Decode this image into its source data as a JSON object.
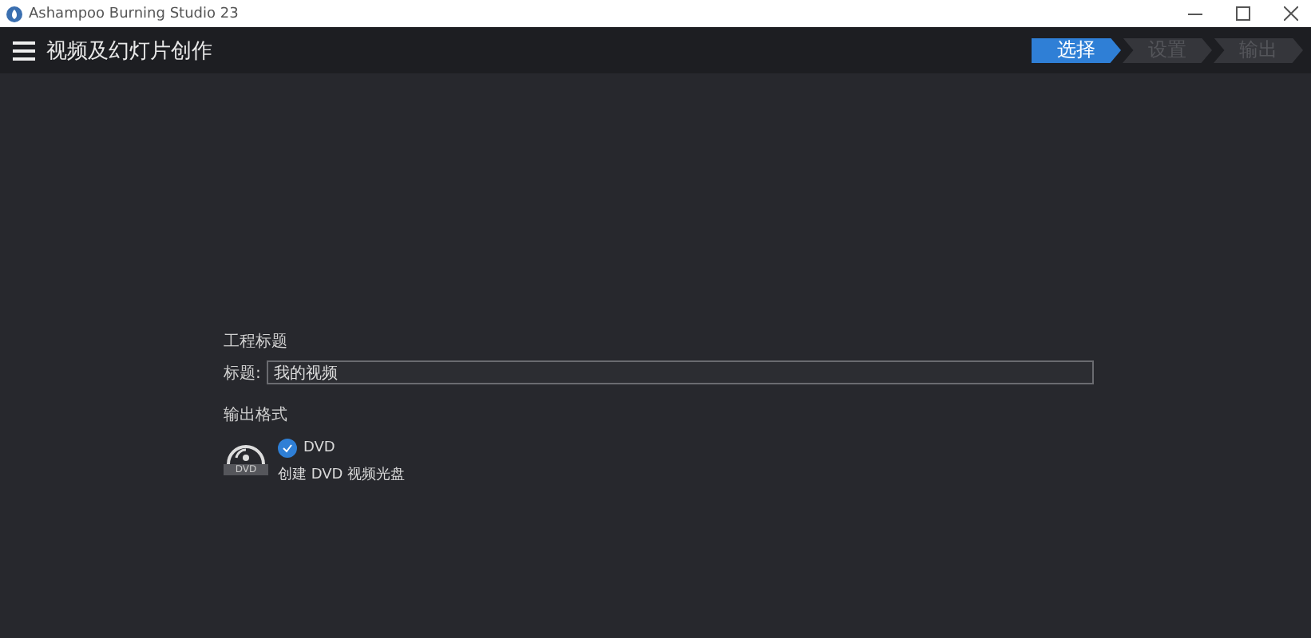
{
  "window": {
    "title": "Ashampoo Burning Studio 23"
  },
  "header": {
    "title": "视频及幻灯片创作"
  },
  "steps": [
    {
      "label": "选择",
      "selected": true
    },
    {
      "label": "设置",
      "selected": false
    },
    {
      "label": "输出",
      "selected": false
    }
  ],
  "project": {
    "heading": "工程标题",
    "field_label": "标题:",
    "value": "我的视频"
  },
  "output": {
    "heading": "输出格式",
    "options": [
      {
        "icon_label": "DVD",
        "name": "DVD",
        "description": "创建 DVD 视频光盘",
        "checked": true
      }
    ]
  }
}
